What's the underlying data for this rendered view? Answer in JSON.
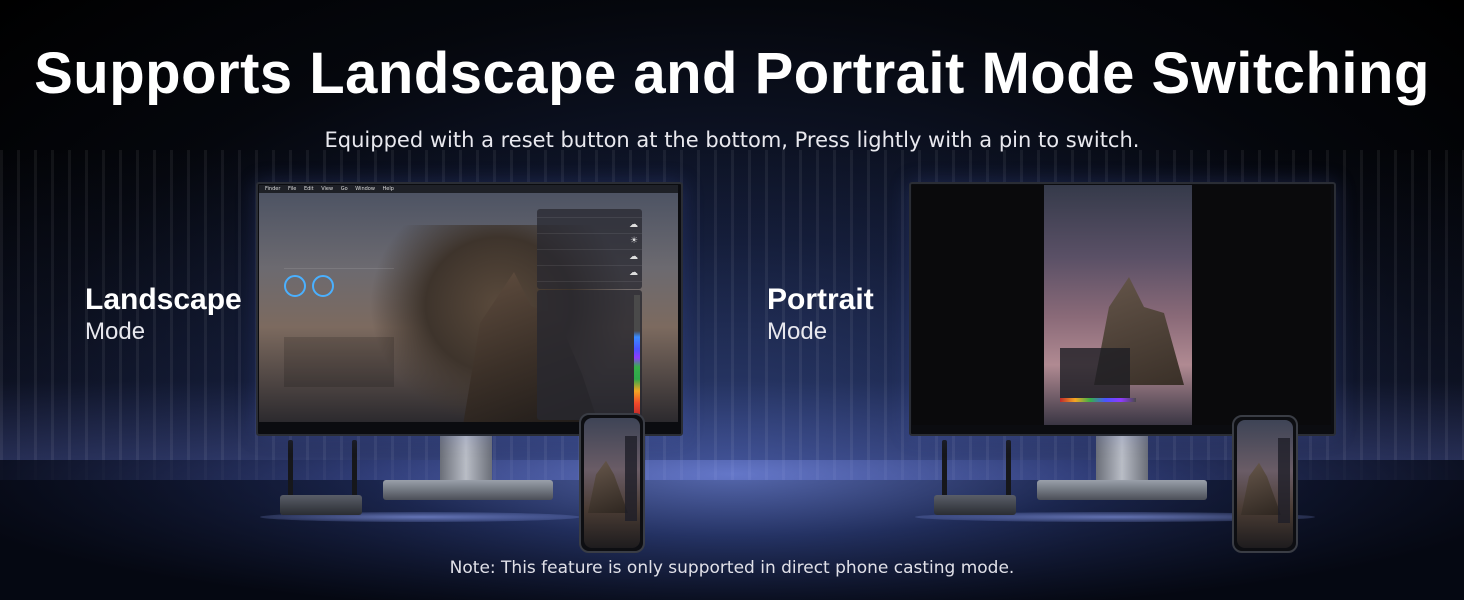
{
  "header": {
    "title": "Supports Landscape and Portrait Mode Switching",
    "subtitle": "Equipped with a reset button at the bottom, Press lightly with a pin to switch."
  },
  "landscape": {
    "label_bold": "Landscape",
    "label_light": "Mode"
  },
  "portrait": {
    "label_bold": "Portrait",
    "label_light": "Mode"
  },
  "screen_menubar": [
    "Finder",
    "File",
    "Edit",
    "View",
    "Go",
    "Window",
    "Help"
  ],
  "footer": {
    "note": "Note: This feature is only supported in direct phone casting mode."
  },
  "colors": {
    "background": "#000000",
    "accent_glow": "#8c9cff"
  }
}
